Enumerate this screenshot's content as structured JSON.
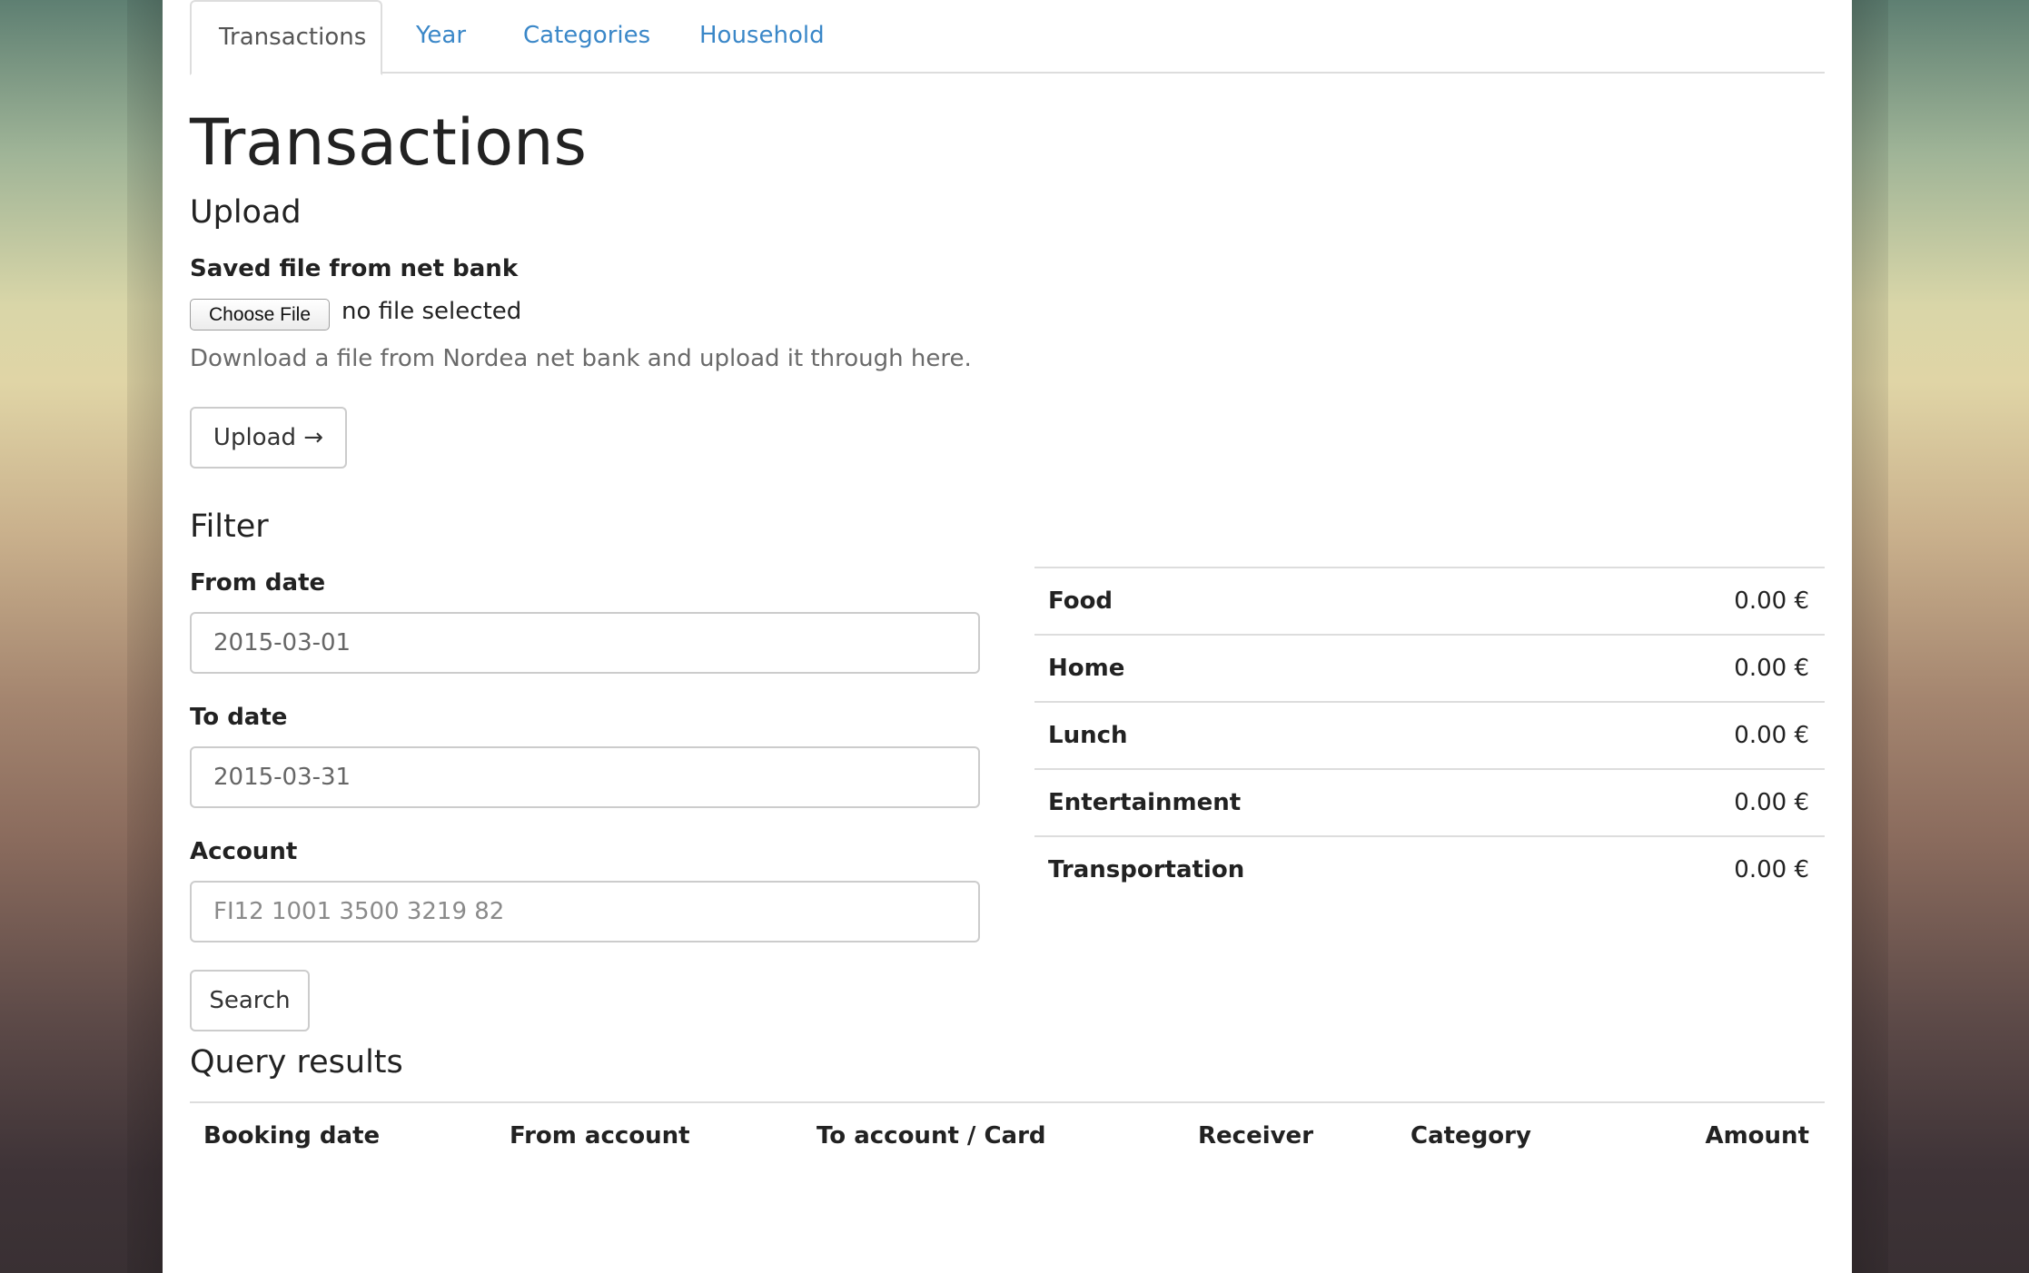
{
  "tabs": [
    "Transactions",
    "Year",
    "Categories",
    "Household"
  ],
  "page_title": "Transactions",
  "upload": {
    "heading": "Upload",
    "file_label": "Saved file from net bank",
    "choose_file": "Choose File",
    "file_status": "no file selected",
    "help_text": "Download a file from Nordea net bank and upload it through here.",
    "button": "Upload →"
  },
  "filter": {
    "heading": "Filter",
    "from_label": "From date",
    "from_value": "2015-03-01",
    "to_label": "To date",
    "to_value": "2015-03-31",
    "account_label": "Account",
    "account_placeholder": "FI12 1001 3500 3219 82",
    "search_button": "Search"
  },
  "category_totals": [
    {
      "name": "Food",
      "amount": "0.00 €"
    },
    {
      "name": "Home",
      "amount": "0.00 €"
    },
    {
      "name": "Lunch",
      "amount": "0.00 €"
    },
    {
      "name": "Entertainment",
      "amount": "0.00 €"
    },
    {
      "name": "Transportation",
      "amount": "0.00 €"
    }
  ],
  "results": {
    "heading": "Query results",
    "columns": [
      "Booking date",
      "From account",
      "To account / Card",
      "Receiver",
      "Category",
      "Amount"
    ]
  },
  "colors": {
    "link": "#3a87c8",
    "border": "#dddddd"
  }
}
